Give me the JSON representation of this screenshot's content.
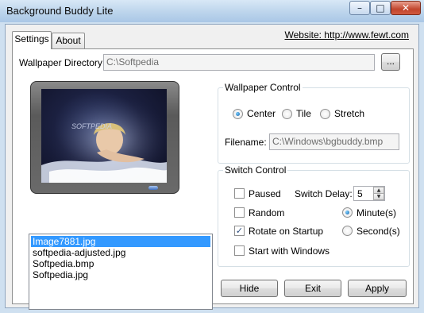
{
  "window": {
    "title": "Background Buddy Lite",
    "minimize_glyph": "–",
    "maximize_glyph": "□",
    "close_glyph": "✕"
  },
  "tabs": {
    "settings": "Settings",
    "about": "About"
  },
  "website": {
    "label": "Website: http://www.fewt.com"
  },
  "wallpaper_directory": {
    "label": "Wallpaper Directory:",
    "value": "C:\\Softpedia",
    "browse_label": "..."
  },
  "preview": {
    "brand_text": "SOFTPEDIA",
    "url_text": "www.softpedia.com",
    "screen_colors": [
      "#0d0f22",
      "#3d4a7a"
    ]
  },
  "wallpaper_control": {
    "title": "Wallpaper Control",
    "options": [
      "Center",
      "Tile",
      "Stretch"
    ],
    "selected": "Center",
    "filename_label": "Filename:",
    "filename_value": "C:\\Windows\\bgbuddy.bmp"
  },
  "switch_control": {
    "title": "Switch Control",
    "paused_label": "Paused",
    "paused": false,
    "random_label": "Random",
    "random": false,
    "rotate_label": "Rotate on Startup",
    "rotate": true,
    "start_label": "Start with Windows",
    "start": false,
    "delay_label": "Switch Delay:",
    "delay_value": "5",
    "unit_options": [
      "Minute(s)",
      "Second(s)"
    ],
    "unit_selected": "Minute(s)"
  },
  "files": {
    "items": [
      "Image7881.jpg",
      "softpedia-adjusted.jpg",
      "Softpedia.bmp",
      "Softpedia.jpg"
    ],
    "selected_index": 0
  },
  "buttons": {
    "hide": "Hide",
    "exit": "Exit",
    "apply": "Apply"
  },
  "colors": {
    "selection": "#3399ff",
    "accent": "#0e5ea8"
  }
}
